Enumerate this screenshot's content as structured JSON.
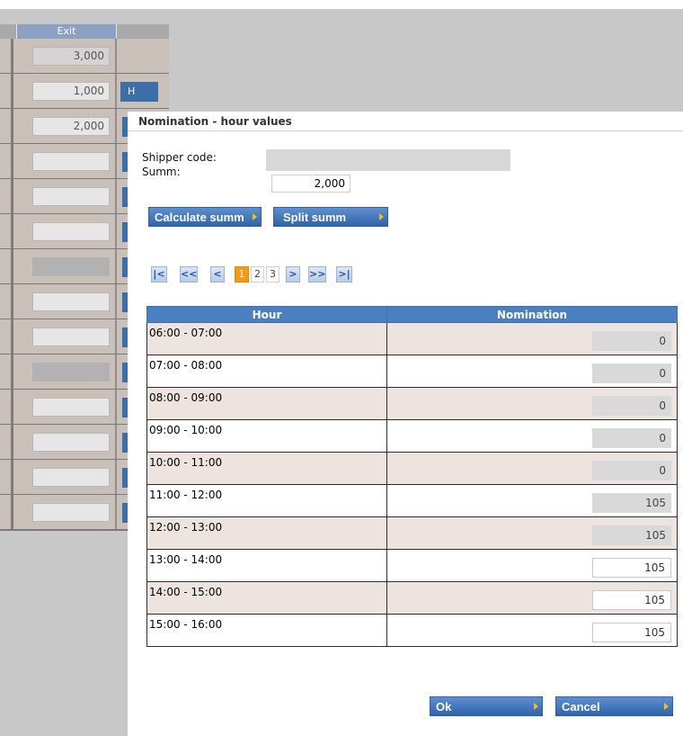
{
  "background": {
    "exit_header": "Exit",
    "rows": [
      {
        "value": "3,000",
        "style": "cell",
        "button": ""
      },
      {
        "value": "1,000",
        "style": "white",
        "button": "H"
      },
      {
        "value": "2,000",
        "style": "white",
        "button": "tab"
      },
      {
        "value": "",
        "style": "white",
        "button": "tab"
      },
      {
        "value": "",
        "style": "white",
        "button": "tab"
      },
      {
        "value": "",
        "style": "white",
        "button": "tab"
      },
      {
        "value": "",
        "style": "dark",
        "button": "tab"
      },
      {
        "value": "",
        "style": "white",
        "button": "tab"
      },
      {
        "value": "",
        "style": "white",
        "button": "tab"
      },
      {
        "value": "",
        "style": "dark",
        "button": "tab"
      },
      {
        "value": "",
        "style": "white",
        "button": "tab"
      },
      {
        "value": "",
        "style": "white",
        "button": "tab"
      },
      {
        "value": "",
        "style": "white",
        "button": "tab"
      },
      {
        "value": "",
        "style": "white",
        "button": "tab"
      }
    ]
  },
  "dialog": {
    "title": "Nomination - hour values",
    "shipper_label": "Shipper code:",
    "shipper_value": "",
    "summ_label": "Summ:",
    "summ_value": "2,000",
    "calculate_label": "Calculate summ",
    "split_label": "Split summ",
    "pager": {
      "first": "|<",
      "prev_block": "<<",
      "prev": "<",
      "pages": [
        "1",
        "2",
        "3"
      ],
      "current_page": "1",
      "next": ">",
      "next_block": ">>",
      "last": ">|"
    },
    "table": {
      "columns": [
        "Hour",
        "Nomination"
      ],
      "rows": [
        {
          "hour": "06:00 - 07:00",
          "nomination": "0",
          "editable": false
        },
        {
          "hour": "07:00 - 08:00",
          "nomination": "0",
          "editable": false
        },
        {
          "hour": "08:00 - 09:00",
          "nomination": "0",
          "editable": false
        },
        {
          "hour": "09:00 - 10:00",
          "nomination": "0",
          "editable": false
        },
        {
          "hour": "10:00 - 11:00",
          "nomination": "0",
          "editable": false
        },
        {
          "hour": "11:00 - 12:00",
          "nomination": "105",
          "editable": false
        },
        {
          "hour": "12:00 - 13:00",
          "nomination": "105",
          "editable": false
        },
        {
          "hour": "13:00 - 14:00",
          "nomination": "105",
          "editable": true
        },
        {
          "hour": "14:00 - 15:00",
          "nomination": "105",
          "editable": true
        },
        {
          "hour": "15:00 - 16:00",
          "nomination": "105",
          "editable": true
        }
      ]
    },
    "ok_label": "Ok",
    "cancel_label": "Cancel"
  },
  "colors": {
    "accent": "#3c6ea8",
    "table_header": "#4a7fc2",
    "row_alt": "#ede4df",
    "current_page": "#f39a12"
  }
}
